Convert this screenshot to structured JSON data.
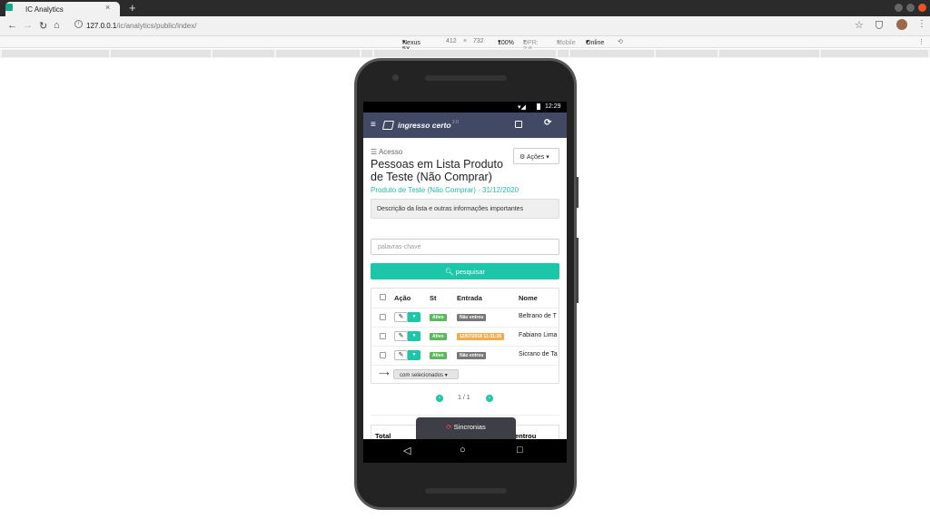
{
  "browser": {
    "tab_title": "IC Analytics",
    "tab_close": "×",
    "new_tab": "+",
    "url_host": "127.0.0.1",
    "url_path": "/ic/analytics/public/index/",
    "icons": [
      "back-icon",
      "forward-icon",
      "reload-icon",
      "home-icon",
      "info-icon",
      "star-icon",
      "shield-icon",
      "avatar",
      "menu-icon"
    ]
  },
  "devtools": {
    "device": "Nexus 5X",
    "width": "412",
    "times": "×",
    "height": "732",
    "zoom": "100%",
    "dpr": "DPR: 2.6",
    "mode": "Mobile",
    "network": "Online"
  },
  "status": {
    "time": "12:29"
  },
  "app": {
    "brand": "ingresso certo",
    "brand_version": "2.0"
  },
  "page": {
    "breadcrumb": "Acesso",
    "title": "Pessoas em Lista Produto de Teste (Não Comprar)",
    "subtitle": "Produto de Teste (Não Comprar) - 31/12/2020",
    "actions_label": "Ações",
    "description": "Descrição da lista e outras informações importantes",
    "search_placeholder": "palavras-chave",
    "search_button": "pesquisar"
  },
  "table": {
    "headers": {
      "acao": "Ação",
      "st": "St",
      "entrada": "Entrada",
      "nome": "Nome"
    },
    "rows": [
      {
        "status": "Ativo",
        "entrada": "Não entrou",
        "nome": "Beltrano de T"
      },
      {
        "status": "Ativo",
        "entrada": "12/07/2018 11:31:26",
        "nome": "Fabiano Lima"
      },
      {
        "status": "Ativo",
        "entrada": "Não entrou",
        "nome": "Sicrano de Ta"
      }
    ],
    "bulk_label": "com selecionados",
    "pagination": "1 / 1"
  },
  "footer": {
    "total_label": "Total",
    "total_col": "entrou",
    "sync_label": "Sincronias"
  },
  "colors": {
    "accent": "#1cc6a8",
    "appbar": "#424964",
    "badge_active": "#5cb85c",
    "badge_not_entered": "#777777",
    "badge_entered": "#f0ad4e"
  }
}
